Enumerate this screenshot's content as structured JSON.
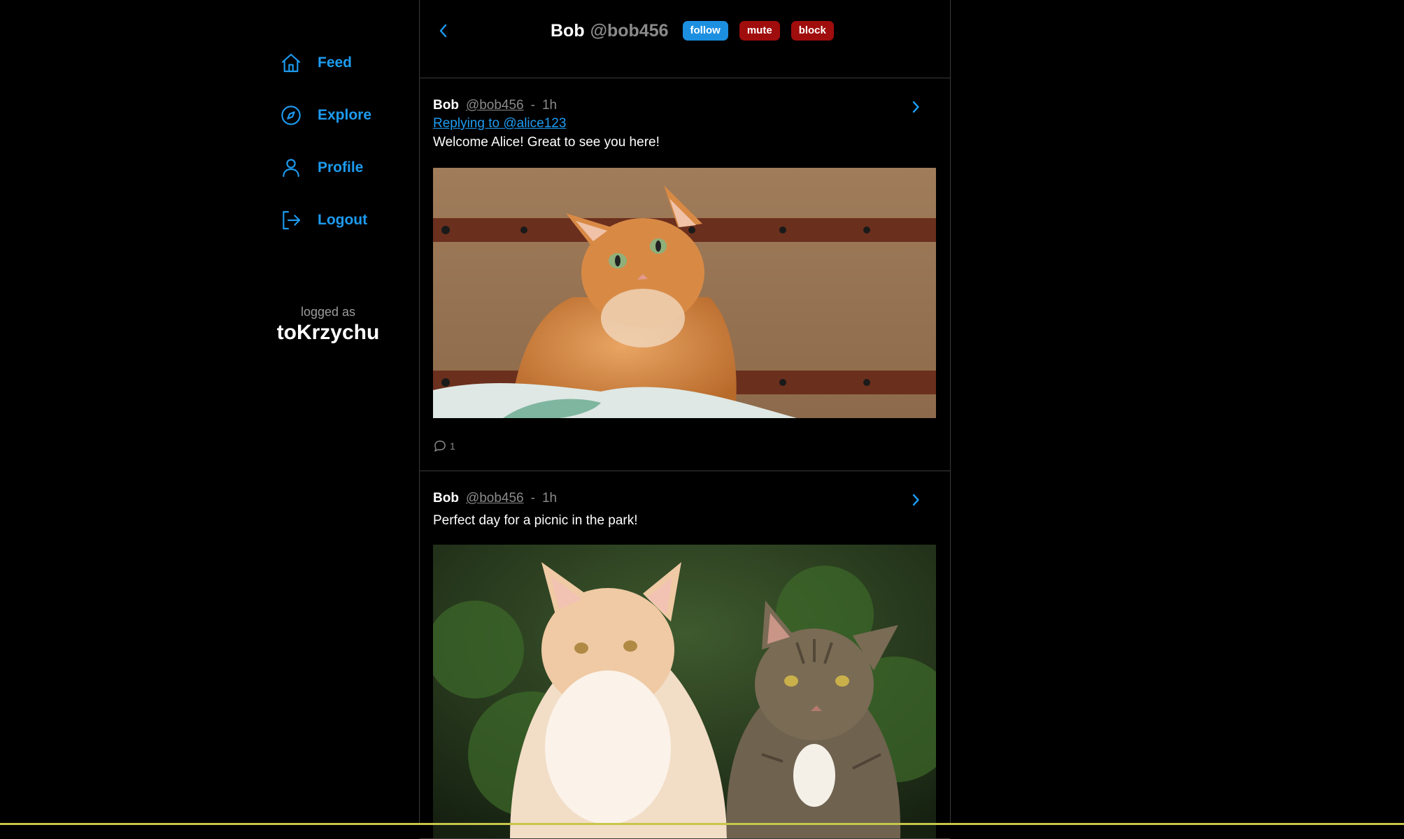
{
  "nav": {
    "items": [
      {
        "label": "Feed",
        "icon": "home-icon"
      },
      {
        "label": "Explore",
        "icon": "compass-icon"
      },
      {
        "label": "Profile",
        "icon": "user-icon"
      },
      {
        "label": "Logout",
        "icon": "logout-icon"
      }
    ],
    "logged_caption": "logged as",
    "username": "toKrzychu"
  },
  "header": {
    "name": "Bob",
    "handle": "@bob456",
    "follow_label": "follow",
    "mute_label": "mute",
    "block_label": "block"
  },
  "posts": [
    {
      "name": "Bob",
      "handle": "@bob456",
      "separator": "-",
      "time": "1h",
      "reply_to": "Replying to @alice123",
      "text": "Welcome Alice! Great to see you here!",
      "image": "ginger-cat-photo",
      "comment_count": "1"
    },
    {
      "name": "Bob",
      "handle": "@bob456",
      "separator": "-",
      "time": "1h",
      "text": "Perfect day for a picnic in the park!",
      "image": "two-cats-photo"
    }
  ],
  "colors": {
    "background": "#000000",
    "accent": "#1d9bf0",
    "danger": "#a00d0d",
    "muted": "#8a8a8a",
    "divider": "#3a3a3a"
  }
}
